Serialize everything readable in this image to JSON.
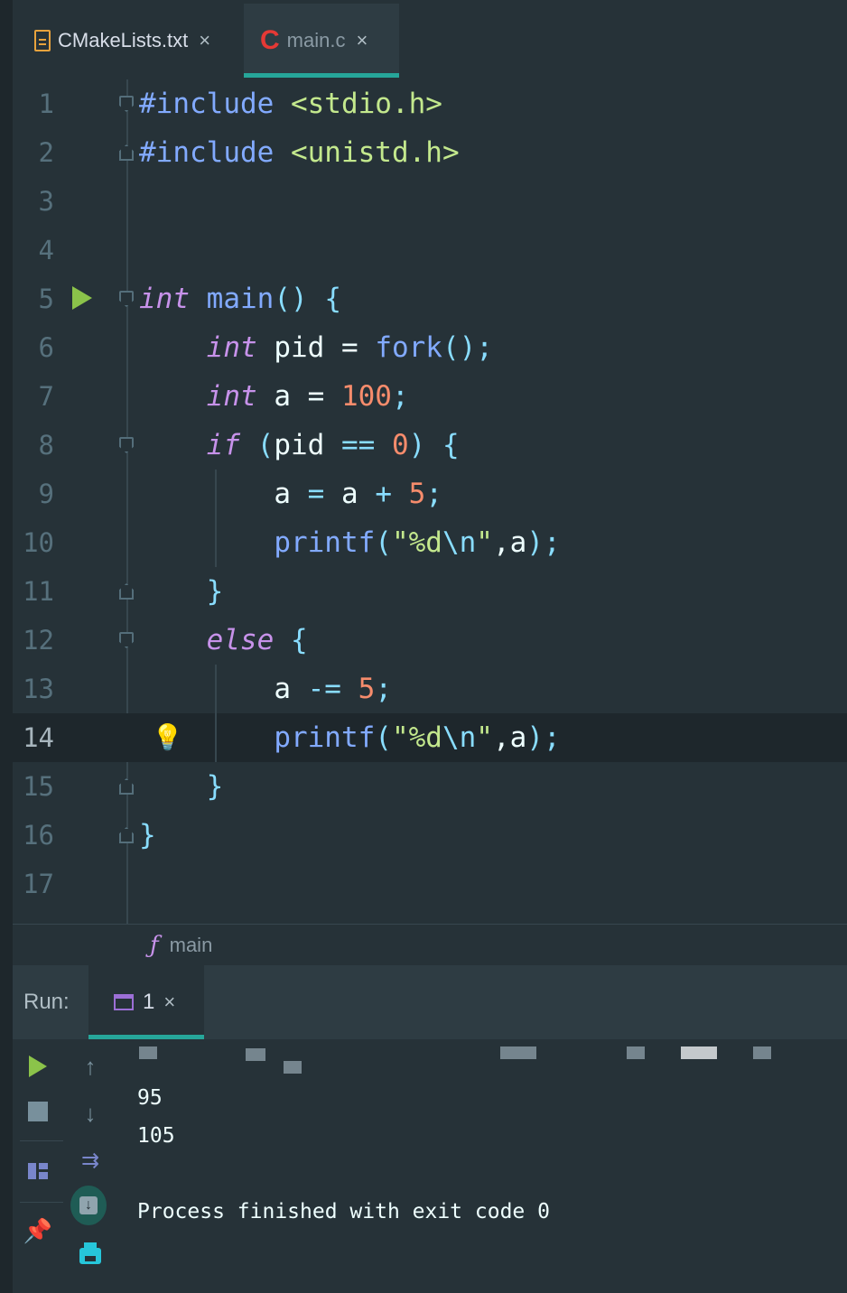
{
  "tabs": [
    {
      "label": "CMakeLists.txt",
      "icon": "text-file-icon",
      "close": "×"
    },
    {
      "label": "main.c",
      "icon": "c-file-icon",
      "close": "×"
    }
  ],
  "editor": {
    "lines": [
      {
        "n": "1"
      },
      {
        "n": "2"
      },
      {
        "n": "3"
      },
      {
        "n": "4"
      },
      {
        "n": "5"
      },
      {
        "n": "6"
      },
      {
        "n": "7"
      },
      {
        "n": "8"
      },
      {
        "n": "9"
      },
      {
        "n": "10"
      },
      {
        "n": "11"
      },
      {
        "n": "12"
      },
      {
        "n": "13"
      },
      {
        "n": "14"
      },
      {
        "n": "15"
      },
      {
        "n": "16"
      },
      {
        "n": "17"
      }
    ],
    "code": {
      "l1_directive": "#include",
      "l1_header": "<stdio.h>",
      "l2_directive": "#include",
      "l2_header": "<unistd.h>",
      "l5_type": "int",
      "l5_name": "main",
      "l5_rest": "() {",
      "l6_type": "int",
      "l6_var": "pid = ",
      "l6_fn": "fork",
      "l6_rest": "();",
      "l7_type": "int",
      "l7_var": "a = ",
      "l7_num": "100",
      "l7_end": ";",
      "l8_kw": "if",
      "l8_open": "(",
      "l8_var": "pid",
      "l8_op": " == ",
      "l8_num": "0",
      "l8_close": ") {",
      "l9_a": "a",
      "l9_eq": " = ",
      "l9_b": "a",
      "l9_plus": " + ",
      "l9_num": "5",
      "l9_end": ";",
      "l10_fn": "printf",
      "l10_open": "(",
      "l10_str1": "\"%d",
      "l10_esc": "\\n",
      "l10_str2": "\"",
      "l10_args": ",a",
      "l10_end": ");",
      "l11": "}",
      "l12_kw": "else",
      "l12_brace": " {",
      "l13_a": "a",
      "l13_op": " -= ",
      "l13_num": "5",
      "l13_end": ";",
      "l14_fn": "printf",
      "l14_open": "(",
      "l14_str1": "\"%d",
      "l14_esc": "\\n",
      "l14_str2": "\"",
      "l14_args": ",a",
      "l14_end": ");",
      "l15": "}",
      "l16": "}"
    },
    "current_line": "14"
  },
  "breadcrumb": {
    "icon": "ƒ",
    "label": "main"
  },
  "run": {
    "label": "Run:",
    "tab_label": "1",
    "tab_close": "×",
    "output": [
      "95",
      "105",
      "",
      "Process finished with exit code 0"
    ]
  },
  "colors": {
    "background": "#263238",
    "accent": "#26a69a",
    "keyword": "#c792ea",
    "function": "#82aaff",
    "number": "#f78c6c",
    "string": "#c3e88d",
    "run_green": "#8bc34a"
  }
}
